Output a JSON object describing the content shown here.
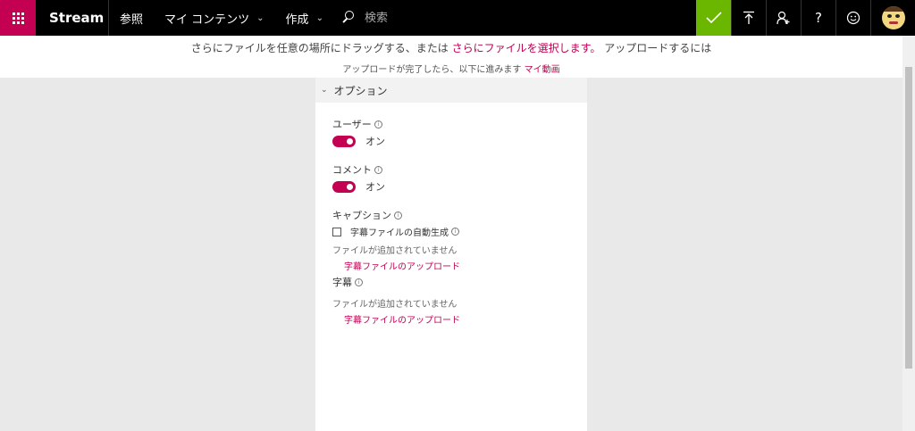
{
  "topbar": {
    "brand": "Stream",
    "nav": [
      {
        "label": "参照"
      },
      {
        "label": "マイ コンテンツ"
      },
      {
        "label": "作成"
      }
    ],
    "search_placeholder": "検索",
    "icons": [
      "waffle-icon",
      "checkmark-icon",
      "upload-icon",
      "add-person-icon",
      "help-icon",
      "smiley-icon",
      "avatar"
    ],
    "accent_color": "#c30052",
    "check_color": "#6bb700"
  },
  "notice": {
    "line1_prefix": "さらにファイルを任意の場所にドラッグする、または",
    "line1_link": "さらにファイルを選択します。",
    "line1_suffix": "アップロードするには",
    "line2_prefix": "アップロードが完了したら、以下に進みます",
    "line2_link": "マイ動画"
  },
  "options": {
    "header": "オプション",
    "users_label": "ユーザー",
    "users_state": "オン",
    "comments_label": "コメント",
    "comments_state": "オン",
    "captions_label": "キャプション",
    "auto_caption_label": "字幕ファイルの自動生成",
    "captions_no_file": "ファイルが追加されていません",
    "captions_upload": "字幕ファイルのアップロード",
    "subtitles_label": "字幕",
    "subtitles_no_file": "ファイルが追加されていません",
    "subtitles_upload": "字幕ファイルのアップロード"
  }
}
